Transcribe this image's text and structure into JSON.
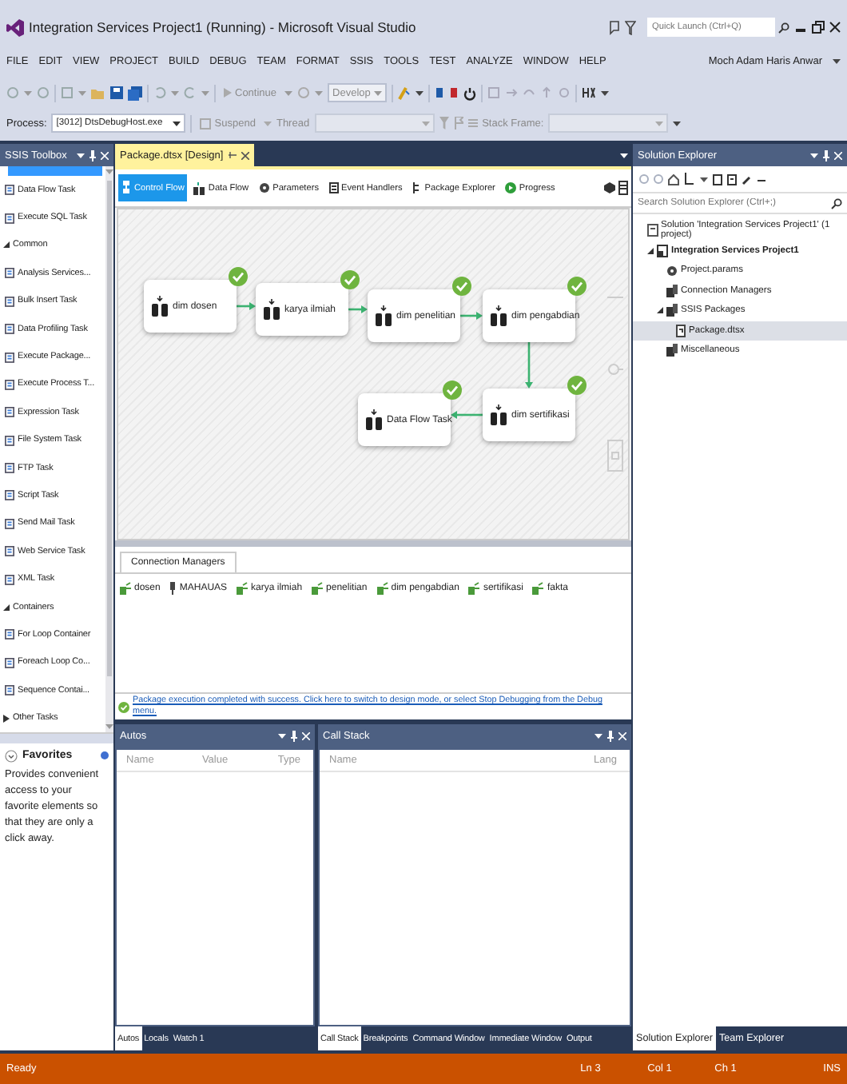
{
  "window": {
    "title": "Integration Services Project1 (Running) - Microsoft Visual Studio",
    "quick_launch": {
      "placeholder": "Quick Launch (Ctrl+Q)"
    }
  },
  "menu": [
    "FILE",
    "EDIT",
    "VIEW",
    "PROJECT",
    "BUILD",
    "DEBUG",
    "TEAM",
    "FORMAT",
    "SSIS",
    "TOOLS",
    "TEST",
    "ANALYZE",
    "WINDOW",
    "HELP"
  ],
  "user": "Moch Adam Haris Anwar",
  "toolbar": {
    "continue": "Continue",
    "configuration": "Develop"
  },
  "debug_location": {
    "process_label": "Process:",
    "process": "[3012] DtsDebugHost.exe",
    "suspend": "Suspend",
    "thread_label": "Thread",
    "stack_frame_label": "Stack Frame:"
  },
  "toolbox": {
    "title": "SSIS Toolbox",
    "items": [
      {
        "kind": "item",
        "label": "Data Flow Task"
      },
      {
        "kind": "item",
        "label": "Execute SQL Task"
      },
      {
        "kind": "group",
        "label": "Common",
        "expanded": true
      },
      {
        "kind": "item",
        "label": "Analysis Services..."
      },
      {
        "kind": "item",
        "label": "Bulk Insert Task"
      },
      {
        "kind": "item",
        "label": "Data Profiling Task"
      },
      {
        "kind": "item",
        "label": "Execute Package..."
      },
      {
        "kind": "item",
        "label": "Execute Process T..."
      },
      {
        "kind": "item",
        "label": "Expression Task"
      },
      {
        "kind": "item",
        "label": "File System Task"
      },
      {
        "kind": "item",
        "label": "FTP Task"
      },
      {
        "kind": "item",
        "label": "Script Task"
      },
      {
        "kind": "item",
        "label": "Send Mail Task"
      },
      {
        "kind": "item",
        "label": "Web Service Task"
      },
      {
        "kind": "item",
        "label": "XML Task"
      },
      {
        "kind": "group",
        "label": "Containers",
        "expanded": true
      },
      {
        "kind": "item",
        "label": "For Loop Container"
      },
      {
        "kind": "item",
        "label": "Foreach Loop Co..."
      },
      {
        "kind": "item",
        "label": "Sequence Contai..."
      },
      {
        "kind": "group",
        "label": "Other Tasks",
        "expanded": false
      }
    ],
    "favorites": {
      "title": "Favorites",
      "description": "Provides convenient access to your favorite elements so that they are only a click away."
    }
  },
  "document": {
    "tab": "Package.dtsx [Design]",
    "designer_tabs": [
      {
        "label": "Control Flow",
        "selected": true
      },
      {
        "label": "Data Flow",
        "selected": false
      },
      {
        "label": "Parameters",
        "selected": false
      },
      {
        "label": "Event Handlers",
        "selected": false
      },
      {
        "label": "Package Explorer",
        "selected": false
      },
      {
        "label": "Progress",
        "selected": false
      }
    ],
    "nodes": [
      {
        "name": "dim dosen",
        "succeeded": true
      },
      {
        "name": "karya ilmiah",
        "succeeded": true
      },
      {
        "name": "dim penelitian",
        "succeeded": true
      },
      {
        "name": "dim pengabdian",
        "succeeded": true
      },
      {
        "name": "dim sertifikasi",
        "succeeded": true
      },
      {
        "name": "Data Flow Task",
        "succeeded": true
      }
    ],
    "connection_managers_tab": "Connection Managers",
    "connection_managers": [
      {
        "name": "dosen",
        "kind": "database"
      },
      {
        "name": "MAHAUAS",
        "kind": "file"
      },
      {
        "name": "karya ilmiah",
        "kind": "database"
      },
      {
        "name": "penelitian",
        "kind": "database"
      },
      {
        "name": "dim pengabdian",
        "kind": "database"
      },
      {
        "name": "sertifikasi",
        "kind": "database"
      },
      {
        "name": "fakta",
        "kind": "database"
      }
    ],
    "message": "Package execution completed with success. Click here to switch to design mode, or select Stop Debugging from the Debug menu."
  },
  "autos": {
    "title": "Autos",
    "columns": [
      "Name",
      "Value",
      "Type"
    ],
    "tabs": [
      {
        "label": "Autos",
        "selected": true
      },
      {
        "label": "Locals",
        "selected": false
      },
      {
        "label": "Watch 1",
        "selected": false
      }
    ]
  },
  "call_stack": {
    "title": "Call Stack",
    "columns": [
      "Name",
      "Lang"
    ],
    "tabs": [
      {
        "label": "Call Stack",
        "selected": true
      },
      {
        "label": "Breakpoints",
        "selected": false
      },
      {
        "label": "Command Window",
        "selected": false
      },
      {
        "label": "Immediate Window",
        "selected": false
      },
      {
        "label": "Output",
        "selected": false
      }
    ]
  },
  "solution_explorer": {
    "title": "Solution Explorer",
    "search": {
      "placeholder": "Search Solution Explorer (Ctrl+;)"
    },
    "tree": [
      {
        "label": "Solution 'Integration Services Project1' (1 project)",
        "kind": "solution",
        "selected": false,
        "children": [
          {
            "label": "Integration Services Project1",
            "kind": "project",
            "selected": false,
            "expanded": true,
            "children": [
              {
                "label": "Project.params",
                "kind": "params",
                "selected": false
              },
              {
                "label": "Connection Managers",
                "kind": "folder",
                "selected": false
              },
              {
                "label": "SSIS Packages",
                "kind": "folder",
                "selected": false,
                "expanded": true,
                "children": [
                  {
                    "label": "Package.dtsx",
                    "kind": "package",
                    "selected": true
                  }
                ]
              },
              {
                "label": "Miscellaneous",
                "kind": "folder",
                "selected": false
              }
            ]
          }
        ]
      }
    ],
    "tabs": [
      {
        "label": "Solution Explorer",
        "selected": true
      },
      {
        "label": "Team Explorer",
        "selected": false
      }
    ]
  },
  "status_bar": {
    "message": "Ready",
    "line": "Ln 3",
    "column": "Col 1",
    "char": "Ch 1",
    "mode": "INS"
  }
}
